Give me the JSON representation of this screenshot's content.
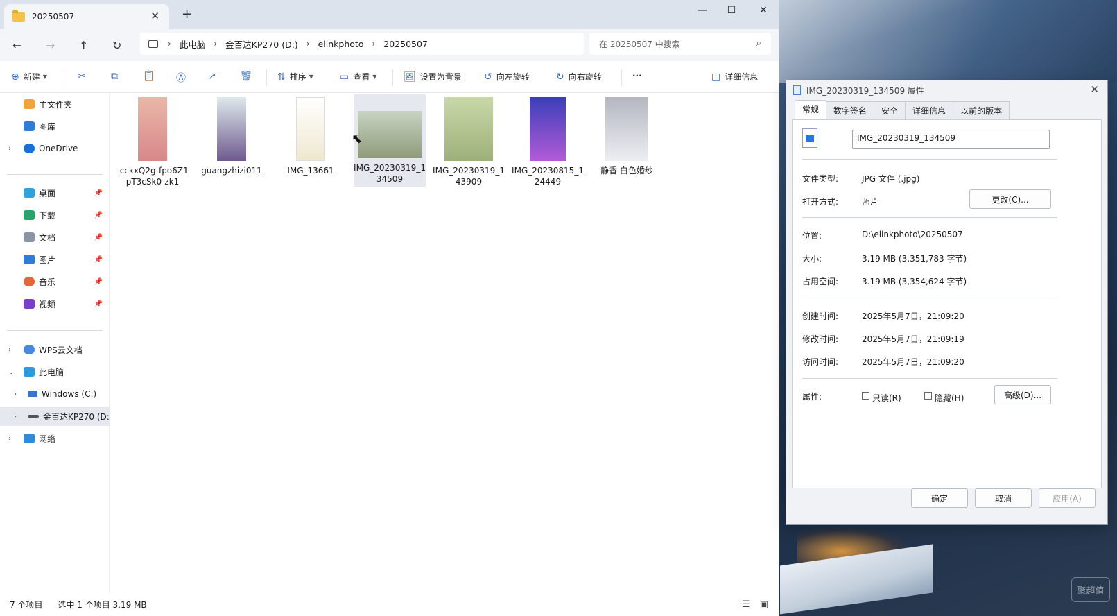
{
  "window": {
    "tab_title": "20250507",
    "close_tab": "✕",
    "new_tab": "+",
    "minimize": "—",
    "maximize": "☐",
    "close": "✕"
  },
  "nav": {
    "back": "←",
    "forward": "→",
    "up": "↑",
    "refresh": "↻",
    "breadcrumb": [
      "此电脑",
      "金百达KP270 (D:)",
      "elinkphoto",
      "20250507"
    ],
    "search_placeholder": "在 20250507 中搜索"
  },
  "toolbar": {
    "new_label": "新建",
    "sort_label": "排序",
    "view_label": "查看",
    "set_background_label": "设置为背景",
    "rotate_left_label": "向左旋转",
    "rotate_right_label": "向右旋转",
    "more_label": "···",
    "details_label": "详细信息"
  },
  "sidebar": {
    "items": [
      {
        "label": "主文件夹"
      },
      {
        "label": "图库"
      },
      {
        "label": "OneDrive"
      },
      {
        "label": "桌面"
      },
      {
        "label": "下载"
      },
      {
        "label": "文档"
      },
      {
        "label": "图片"
      },
      {
        "label": "音乐"
      },
      {
        "label": "视频"
      },
      {
        "label": "WPS云文档"
      },
      {
        "label": "此电脑"
      },
      {
        "label": "Windows (C:)"
      },
      {
        "label": "金百达KP270 (D:"
      },
      {
        "label": "网络"
      }
    ]
  },
  "files": [
    {
      "name": "-cckxQ2g-fpo6Z1pT3cSk0-zk1",
      "thumb_color": "#d88b8b"
    },
    {
      "name": "guangzhizi011",
      "thumb_color": "#6f5a8e"
    },
    {
      "name": "IMG_13661",
      "thumb_color": "#f4f1e8"
    },
    {
      "name": "IMG_20230319_134509",
      "thumb_color": "#8f9b7a"
    },
    {
      "name": "IMG_20230319_143909",
      "thumb_color": "#9db07a"
    },
    {
      "name": "IMG_20230815_124449",
      "thumb_color": "#6a3fb8"
    },
    {
      "name": "静香 白色婚纱",
      "thumb_color": "#cfd0d6"
    }
  ],
  "status": {
    "count": "7 个项目",
    "selected": "选中 1 个项目  3.19 MB"
  },
  "dialog": {
    "title": "IMG_20230319_134509 属性",
    "tabs": [
      "常规",
      "数字签名",
      "安全",
      "详细信息",
      "以前的版本"
    ],
    "filename": "IMG_20230319_134509",
    "file_type_key": "文件类型:",
    "file_type_value": "JPG 文件 (.jpg)",
    "open_with_key": "打开方式:",
    "open_with_value": "照片",
    "change_button": "更改(C)...",
    "location_key": "位置:",
    "location_value": "D:\\elinkphoto\\20250507",
    "size_key": "大小:",
    "size_value": "3.19 MB (3,351,783 字节)",
    "disk_size_key": "占用空间:",
    "disk_size_value": "3.19 MB (3,354,624 字节)",
    "created_key": "创建时间:",
    "created_value": "2025年5月7日，21:09:20",
    "modified_key": "修改时间:",
    "modified_value": "2025年5月7日，21:09:19",
    "accessed_key": "访问时间:",
    "accessed_value": "2025年5月7日，21:09:20",
    "attributes_key": "属性:",
    "readonly_label": "只读(R)",
    "hidden_label": "隐藏(H)",
    "advanced_button": "高级(D)...",
    "ok_button": "确定",
    "cancel_button": "取消",
    "apply_button": "应用(A)"
  },
  "watermark": "聚超值"
}
